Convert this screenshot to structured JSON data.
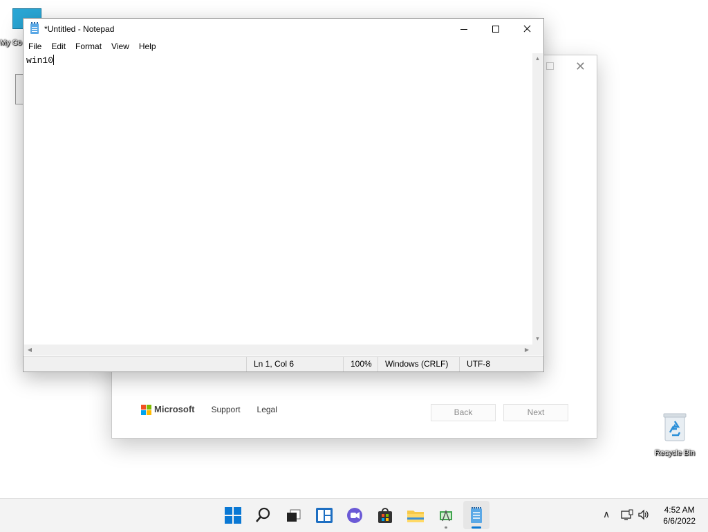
{
  "desktop": {
    "my_computer_label": "My Co",
    "recycle_bin_label": "Recycle Bin"
  },
  "setup_window": {
    "brand": "Microsoft",
    "support_link": "Support",
    "legal_link": "Legal",
    "back_button": "Back",
    "next_button": "Next"
  },
  "notepad": {
    "title": "*Untitled - Notepad",
    "menu": [
      "File",
      "Edit",
      "Format",
      "View",
      "Help"
    ],
    "content": "win10",
    "status": {
      "position": "Ln 1, Col 6",
      "zoom": "100%",
      "line_ending": "Windows (CRLF)",
      "encoding": "UTF-8"
    }
  },
  "taskbar": {
    "clock_time": "4:52 AM",
    "clock_date": "6/6/2022"
  }
}
